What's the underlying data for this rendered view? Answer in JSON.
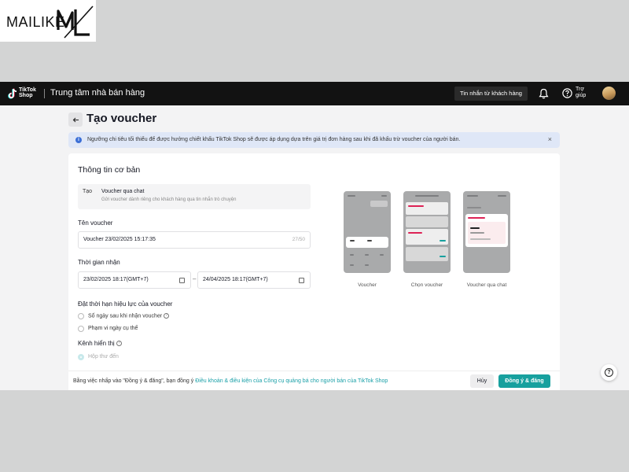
{
  "watermark": {
    "text": "MAILIKE",
    "monogram": "ML"
  },
  "topbar": {
    "brand_line1": "TikTok",
    "brand_line2": "Shop",
    "title": "Trung tâm nhà bán hàng",
    "messages_button": "Tin nhắn từ khách hàng",
    "help_label": "Trợ giúp",
    "icons": [
      "tiktok-logo-icon",
      "bell-icon",
      "help-icon",
      "avatar"
    ]
  },
  "page": {
    "back_icon": "arrow-left-icon",
    "title": "Tạo voucher"
  },
  "notice": {
    "text": "Ngưỡng chi tiêu tối thiểu để được hưởng chiết khấu TikTok Shop sẽ được áp dụng dựa trên giá trị đơn hàng sau khi đã khấu trừ voucher của người bán.",
    "close": "×"
  },
  "form": {
    "section_title": "Thông tin cơ bản",
    "type": {
      "label": "Tạo",
      "value": "Voucher qua chat",
      "description": "Gửi voucher dành riêng cho khách hàng qua tin nhắn trò chuyện"
    },
    "name": {
      "label": "Tên voucher",
      "value": "Voucher 23/02/2025 15:17:35",
      "counter": "27/50"
    },
    "period": {
      "label": "Thời gian nhận",
      "start": "23/02/2025 18:17(GMT+7)",
      "separator": "–",
      "end": "24/04/2025 18:17(GMT+7)"
    },
    "validity": {
      "label": "Đặt thời hạn hiệu lực của voucher",
      "options": [
        "Số ngày sau khi nhận voucher",
        "Phạm vi ngày cụ thể"
      ],
      "help_mark": "?"
    },
    "channel": {
      "label": "Kênh hiển thị",
      "help_mark": "?",
      "options": [
        "Hộp thư đến"
      ]
    }
  },
  "previews": [
    {
      "caption": "Voucher"
    },
    {
      "caption": "Chọn voucher"
    },
    {
      "caption": "Voucher qua chat"
    }
  ],
  "footer": {
    "text": "Bằng việc nhấp vào \"Đồng ý & đăng\", bạn đồng ý",
    "link": "Điều khoản & điều kiện của Công cụ quảng bá cho người bán của TikTok Shop",
    "cancel": "Hủy",
    "submit": "Đồng ý & đăng"
  },
  "fab": {
    "icon": "help-icon",
    "glyph": "?"
  },
  "colors": {
    "accent": "#17a09e",
    "link": "#1aa0a8",
    "topbar": "#121212",
    "notice_bg": "#dfe7f7"
  }
}
